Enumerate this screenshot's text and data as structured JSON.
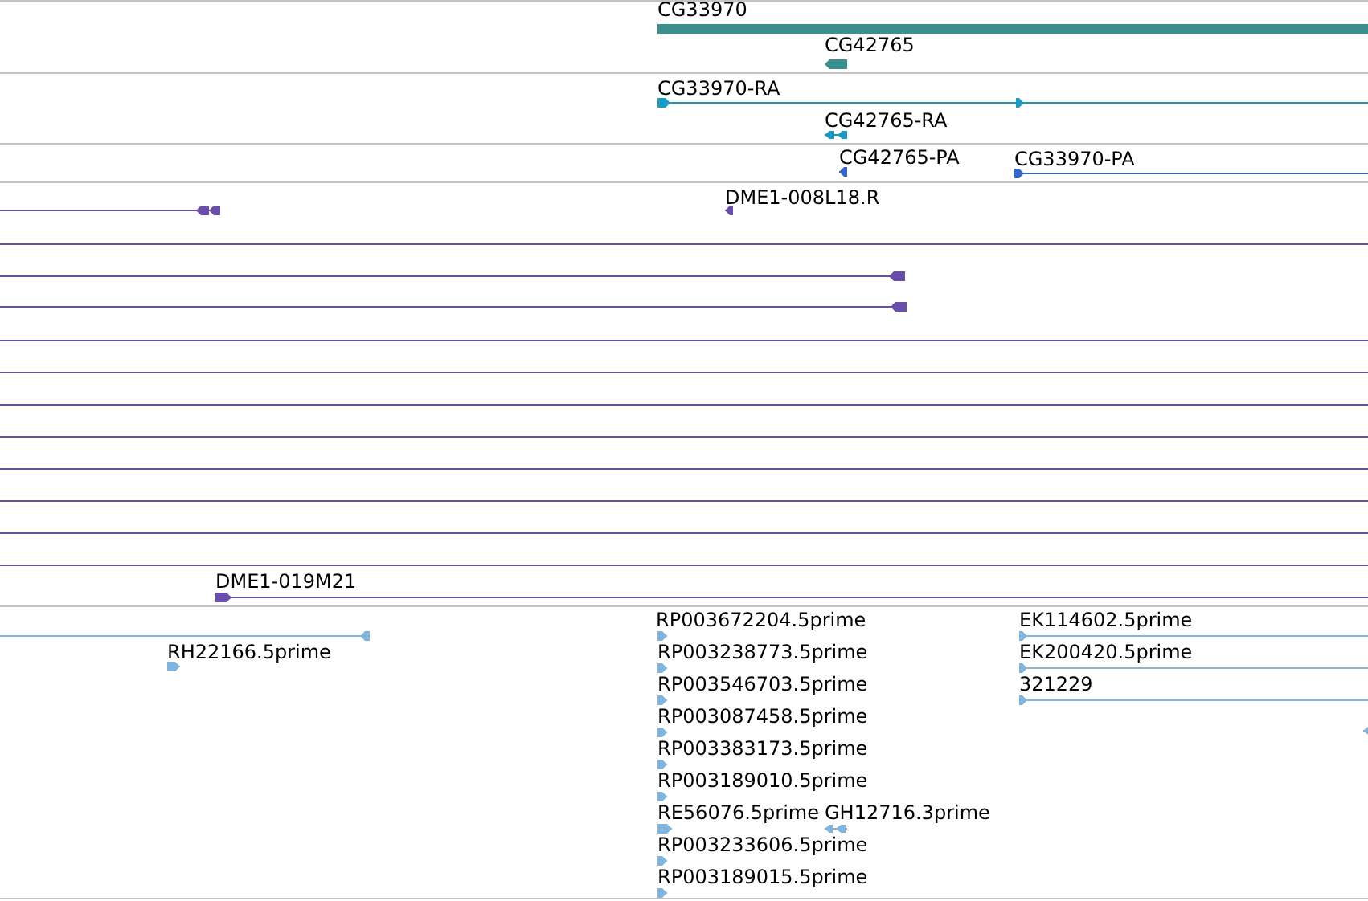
{
  "tracks": [
    {
      "color": "#3a8f8f",
      "features": [
        {
          "kind": "glyph",
          "label": "CG33970"
        },
        {
          "kind": "glyph",
          "label": "CG42765",
          "reverse": true
        }
      ]
    },
    {
      "color": "#1a9cc0",
      "features": [
        {
          "kind": "glyph",
          "label": "CG33970-RA",
          "reverse": false
        },
        {
          "kind": "glyph",
          "label": "CG42765-RA",
          "reverse": true
        }
      ]
    },
    {
      "color": "#3366cc",
      "features": [
        {
          "kind": "glyph",
          "label": "CG42765-PA",
          "reverse": true
        },
        {
          "kind": "glyph",
          "label": "CG33970-PA",
          "reverse": false
        }
      ]
    },
    {
      "color": "#6a4faa",
      "features": [
        {
          "kind": "glyph",
          "label": "DME1-008L18.R",
          "reverse": true
        },
        {
          "kind": "glyph",
          "reverse": true
        },
        {
          "kind": "span"
        },
        {
          "kind": "glyph",
          "reverse": true
        },
        {
          "kind": "glyph",
          "reverse": true
        },
        {
          "kind": "span"
        },
        {
          "kind": "span"
        },
        {
          "kind": "span"
        },
        {
          "kind": "span"
        },
        {
          "kind": "span"
        },
        {
          "kind": "span"
        },
        {
          "kind": "span"
        },
        {
          "kind": "span"
        },
        {
          "kind": "glyph",
          "label": "DME1-019M21",
          "reverse": false
        }
      ]
    },
    {
      "color": "#80b4dc",
      "features": [
        {
          "kind": "glyph",
          "reverse": true
        },
        {
          "kind": "glyph",
          "label": "RH22166.5prime",
          "reverse": false
        },
        {
          "kind": "glyph",
          "label": "RP003672204.5prime",
          "reverse": false
        },
        {
          "kind": "glyph",
          "label": "RP003238773.5prime",
          "reverse": false
        },
        {
          "kind": "glyph",
          "label": "RP003546703.5prime",
          "reverse": false
        },
        {
          "kind": "glyph",
          "label": "RP003087458.5prime",
          "reverse": false
        },
        {
          "kind": "glyph",
          "label": "RP003383173.5prime",
          "reverse": false
        },
        {
          "kind": "glyph",
          "label": "RP003189010.5prime",
          "reverse": false
        },
        {
          "kind": "glyph",
          "label": "RE56076.5prime",
          "reverse": false
        },
        {
          "kind": "glyph",
          "label": "GH12716.3prime",
          "reverse": true
        },
        {
          "kind": "glyph",
          "label": "RP003233606.5prime",
          "reverse": false
        },
        {
          "kind": "glyph",
          "label": "RP003189015.5prime",
          "reverse": false
        },
        {
          "kind": "glyph",
          "label": "EK114602.5prime",
          "reverse": false
        },
        {
          "kind": "glyph",
          "label": "EK200420.5prime",
          "reverse": false
        },
        {
          "kind": "glyph",
          "label": "321229",
          "reverse": false
        },
        {
          "kind": "glyph",
          "reverse": true
        }
      ]
    }
  ]
}
